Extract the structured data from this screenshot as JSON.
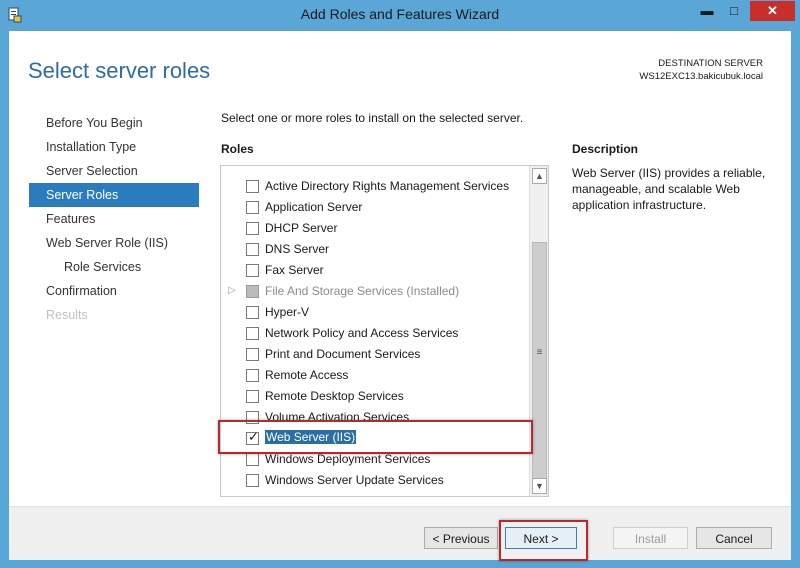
{
  "window": {
    "title": "Add Roles and Features Wizard",
    "min_glyph": "▬",
    "max_glyph": "□",
    "close_glyph": "✕"
  },
  "header": {
    "page_title": "Select server roles",
    "dest_label": "DESTINATION SERVER",
    "dest_server": "WS12EXC13.bakicubuk.local"
  },
  "nav": {
    "items": [
      {
        "label": "Before You Begin",
        "state": "normal"
      },
      {
        "label": "Installation Type",
        "state": "normal"
      },
      {
        "label": "Server Selection",
        "state": "normal"
      },
      {
        "label": "Server Roles",
        "state": "active"
      },
      {
        "label": "Features",
        "state": "normal"
      },
      {
        "label": "Web Server Role (IIS)",
        "state": "normal"
      },
      {
        "label": "Role Services",
        "state": "indent"
      },
      {
        "label": "Confirmation",
        "state": "normal"
      },
      {
        "label": "Results",
        "state": "disabled"
      }
    ]
  },
  "main": {
    "instruction": "Select one or more roles to install on the selected server.",
    "roles_label": "Roles",
    "roles": [
      {
        "label": "Active Directory Rights Management Services",
        "checked": false
      },
      {
        "label": "Application Server",
        "checked": false
      },
      {
        "label": "DHCP Server",
        "checked": false
      },
      {
        "label": "DNS Server",
        "checked": false
      },
      {
        "label": "Fax Server",
        "checked": false
      },
      {
        "label": "File And Storage Services (Installed)",
        "checked": "partial"
      },
      {
        "label": "Hyper-V",
        "checked": false
      },
      {
        "label": "Network Policy and Access Services",
        "checked": false
      },
      {
        "label": "Print and Document Services",
        "checked": false
      },
      {
        "label": "Remote Access",
        "checked": false
      },
      {
        "label": "Remote Desktop Services",
        "checked": false
      },
      {
        "label": "Volume Activation Services",
        "checked": false
      },
      {
        "label": "Web Server (IIS)",
        "checked": true
      },
      {
        "label": "Windows Deployment Services",
        "checked": false
      },
      {
        "label": "Windows Server Update Services",
        "checked": false
      }
    ],
    "check_glyph": "✓",
    "expander_glyph": "▷",
    "scroll_up_glyph": "▲",
    "scroll_down_glyph": "▼",
    "scroll_grip_glyph": "≡"
  },
  "description": {
    "label": "Description",
    "text": "Web Server (IIS) provides a reliable, manageable, and scalable Web application infrastructure."
  },
  "footer": {
    "previous_label": "< Previous",
    "next_label": "Next >",
    "install_label": "Install",
    "cancel_label": "Cancel"
  },
  "colors": {
    "frame": "#5aa6d6",
    "accent": "#2b6ea3",
    "nav_active": "#2b7bbf",
    "highlight_border": "#b52a2e",
    "close_button": "#c7302a"
  }
}
